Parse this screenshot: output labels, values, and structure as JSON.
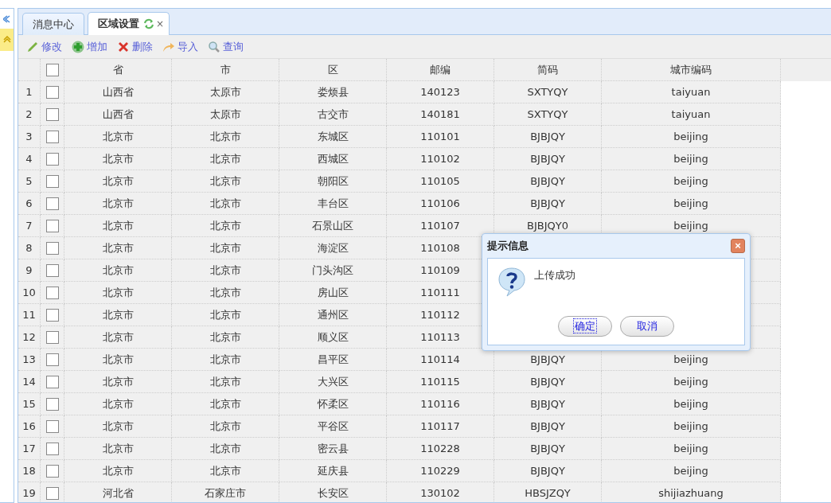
{
  "tabs": [
    {
      "label": "消息中心",
      "selected": false
    },
    {
      "label": "区域设置",
      "selected": true,
      "close": "×"
    }
  ],
  "toolbar": [
    {
      "kind": "edit",
      "label": "修改"
    },
    {
      "kind": "add",
      "label": "增加"
    },
    {
      "kind": "delete",
      "label": "删除"
    },
    {
      "kind": "import",
      "label": "导入"
    },
    {
      "kind": "search",
      "label": "查询"
    }
  ],
  "table": {
    "all_checked": false,
    "columns": [
      "省",
      "市",
      "区",
      "邮编",
      "简码",
      "城市编码"
    ],
    "rows": [
      {
        "num": "1",
        "checked": false,
        "cells": [
          "山西省",
          "太原市",
          "娄烦县",
          "140123",
          "SXTYQY",
          "taiyuan"
        ]
      },
      {
        "num": "2",
        "checked": false,
        "cells": [
          "山西省",
          "太原市",
          "古交市",
          "140181",
          "SXTYQY",
          "taiyuan"
        ]
      },
      {
        "num": "3",
        "checked": false,
        "cells": [
          "北京市",
          "北京市",
          "东城区",
          "110101",
          "BJBJQY",
          "beijing"
        ]
      },
      {
        "num": "4",
        "checked": false,
        "cells": [
          "北京市",
          "北京市",
          "西城区",
          "110102",
          "BJBJQY",
          "beijing"
        ]
      },
      {
        "num": "5",
        "checked": false,
        "cells": [
          "北京市",
          "北京市",
          "朝阳区",
          "110105",
          "BJBJQY",
          "beijing"
        ]
      },
      {
        "num": "6",
        "checked": false,
        "cells": [
          "北京市",
          "北京市",
          "丰台区",
          "110106",
          "BJBJQY",
          "beijing"
        ]
      },
      {
        "num": "7",
        "checked": false,
        "cells": [
          "北京市",
          "北京市",
          "石景山区",
          "110107",
          "BJBJQY0",
          "beijing"
        ]
      },
      {
        "num": "8",
        "checked": false,
        "cells": [
          "北京市",
          "北京市",
          "海淀区",
          "110108"
        ]
      },
      {
        "num": "9",
        "checked": false,
        "cells": [
          "北京市",
          "北京市",
          "门头沟区",
          "110109"
        ]
      },
      {
        "num": "10",
        "checked": false,
        "cells": [
          "北京市",
          "北京市",
          "房山区",
          "110111"
        ]
      },
      {
        "num": "11",
        "checked": false,
        "cells": [
          "北京市",
          "北京市",
          "通州区",
          "110112"
        ]
      },
      {
        "num": "12",
        "checked": false,
        "cells": [
          "北京市",
          "北京市",
          "顺义区",
          "110113"
        ]
      },
      {
        "num": "13",
        "checked": false,
        "cells": [
          "北京市",
          "北京市",
          "昌平区",
          "110114",
          "BJBJQY",
          "beijing"
        ]
      },
      {
        "num": "14",
        "checked": false,
        "cells": [
          "北京市",
          "北京市",
          "大兴区",
          "110115",
          "BJBJQY",
          "beijing"
        ]
      },
      {
        "num": "15",
        "checked": false,
        "cells": [
          "北京市",
          "北京市",
          "怀柔区",
          "110116",
          "BJBJQY",
          "beijing"
        ]
      },
      {
        "num": "16",
        "checked": false,
        "cells": [
          "北京市",
          "北京市",
          "平谷区",
          "110117",
          "BJBJQY",
          "beijing"
        ]
      },
      {
        "num": "17",
        "checked": false,
        "cells": [
          "北京市",
          "北京市",
          "密云县",
          "110228",
          "BJBJQY",
          "beijing"
        ]
      },
      {
        "num": "18",
        "checked": false,
        "cells": [
          "北京市",
          "北京市",
          "延庆县",
          "110229",
          "BJBJQY",
          "beijing"
        ]
      },
      {
        "num": "19",
        "checked": false,
        "cells": [
          "河北省",
          "石家庄市",
          "长安区",
          "130102",
          "HBSJZQY",
          "shijiazhuang"
        ]
      }
    ]
  },
  "dialog": {
    "title": "提示信息",
    "close": "×",
    "message": "上传成功",
    "buttons": [
      {
        "label": "确定",
        "focused": true
      },
      {
        "label": "取消",
        "focused": false
      }
    ]
  }
}
